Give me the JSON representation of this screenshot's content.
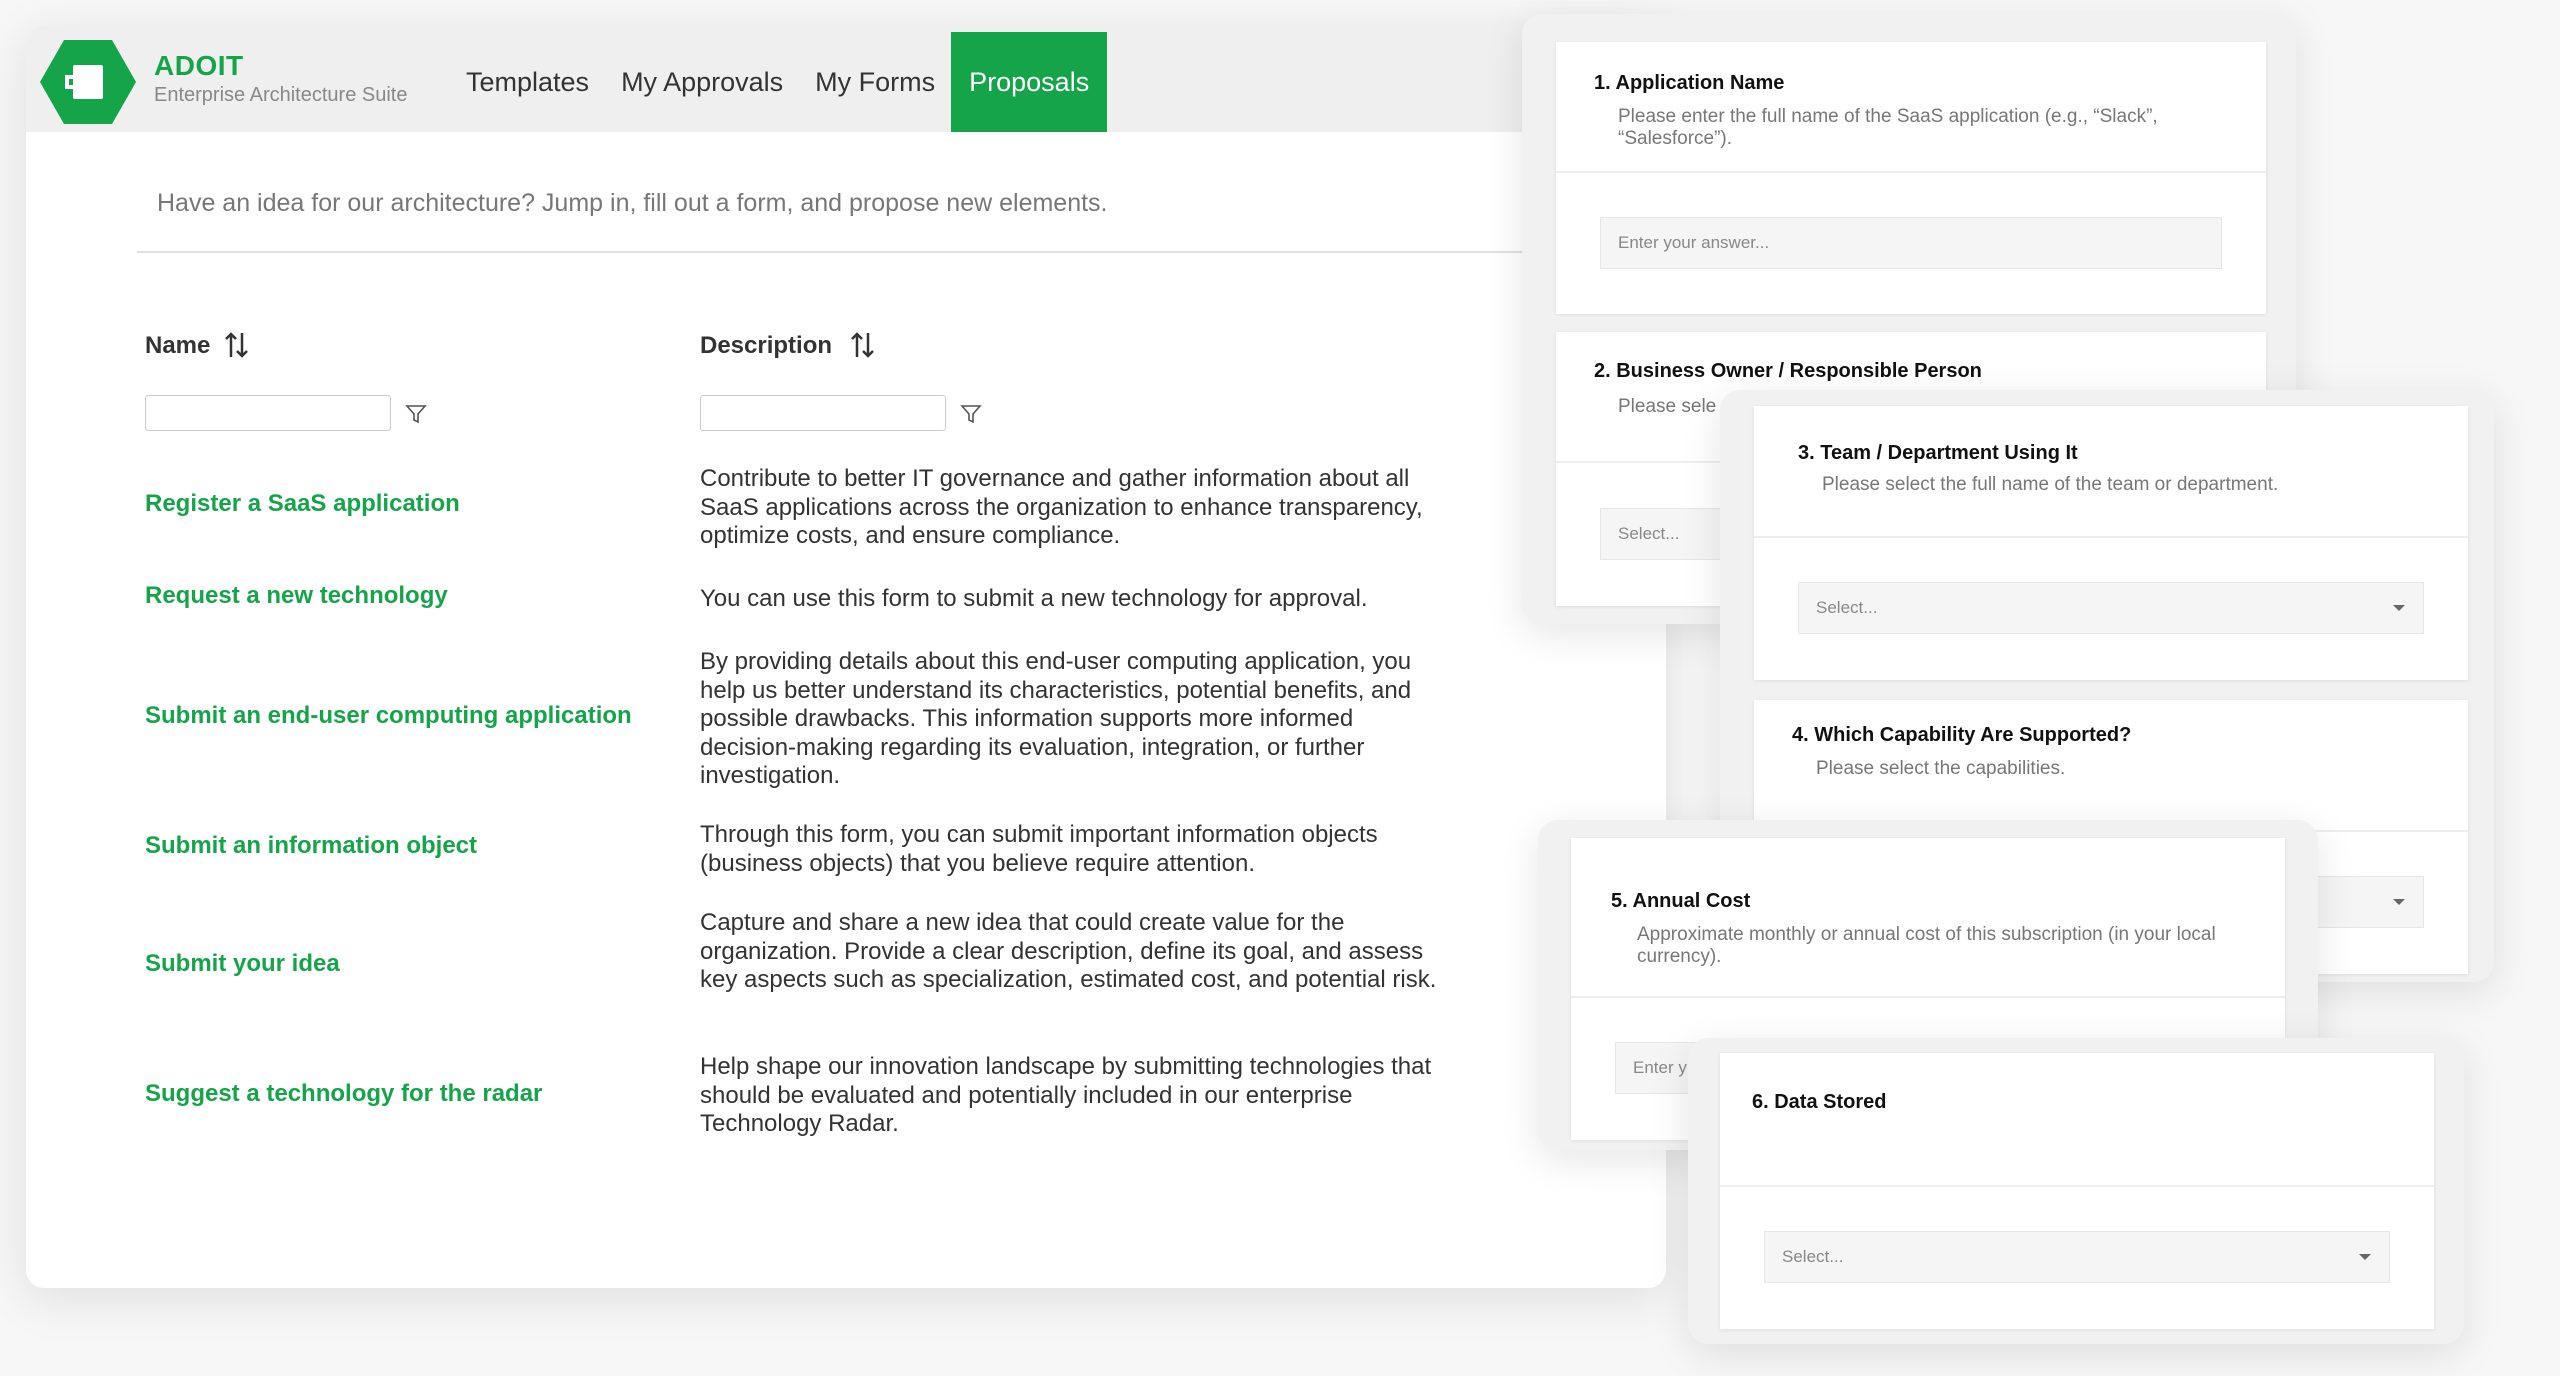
{
  "app": {
    "brand_name": "ADOIT",
    "brand_subtitle": "Enterprise Architecture Suite",
    "nav": {
      "templates": "Templates",
      "my_approvals": "My Approvals",
      "my_forms": "My Forms",
      "proposals": "Proposals"
    },
    "intro_text": "Have an idea for our architecture? Jump in, fill out a form, and propose new elements.",
    "columns": {
      "name": "Name",
      "description": "Description"
    },
    "rows": [
      {
        "name": "Register a SaaS application",
        "description": "Contribute to better IT governance and gather information about all SaaS applications across the organization to enhance transparency, optimize costs, and ensure compliance."
      },
      {
        "name": "Request a new technology",
        "description": "You can use this form to submit a new technology for approval."
      },
      {
        "name": "Submit an end-user computing application",
        "description": "By providing details about this end-user computing application, you help us better understand its characteristics, potential benefits, and possible drawbacks. This information supports more informed decision-making regarding its evaluation, integration, or further investigation."
      },
      {
        "name": "Submit an information object",
        "description": "Through this form, you can submit important information objects (business objects) that you believe require attention."
      },
      {
        "name": "Submit your idea",
        "description": "Capture and share a new idea that could create value for the organization. Provide a clear description, define its goal, and assess key aspects such as specialization, estimated cost, and potential risk."
      },
      {
        "name": "Suggest a technology for the radar",
        "description": "Help shape our innovation landscape by submitting technologies that should be evaluated and potentially included in our enterprise Technology Radar."
      }
    ],
    "colors": {
      "accent": "#16a44a"
    }
  },
  "forms": {
    "q1": {
      "title": "1. Application Name",
      "help": "Please enter the full name of the SaaS application (e.g., “Slack”, “Salesforce”).",
      "placeholder": "Enter your answer..."
    },
    "q2": {
      "title": "2. Business Owner / Responsible Person",
      "help": "Please sele",
      "placeholder": "Select..."
    },
    "q3": {
      "title": "3. Team / Department Using It",
      "help": "Please select the full name of the team or department.",
      "placeholder": "Select..."
    },
    "q4": {
      "title": "4. Which Capability Are Supported?",
      "help": "Please select the capabilities."
    },
    "q5": {
      "title": "5. Annual Cost",
      "help": "Approximate monthly or annual cost of this subscription (in your local currency).",
      "placeholder": "Enter y"
    },
    "q6": {
      "title": "6. Data Stored",
      "placeholder": "Select..."
    }
  }
}
